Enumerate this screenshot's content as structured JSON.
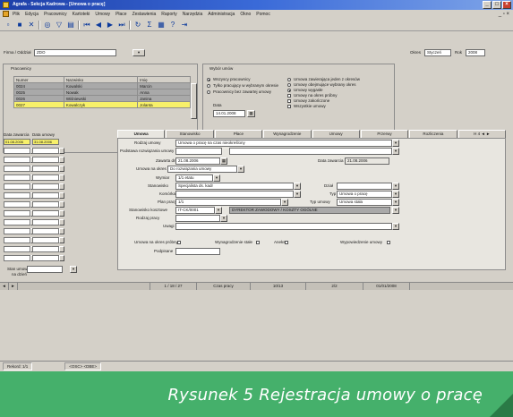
{
  "window": {
    "title": "Agrafa - Sekcja Kadrowa - [Umowa o pracę]"
  },
  "menu": [
    "Plik",
    "Edycja",
    "Pracownicy",
    "Kartoteki",
    "Umowy",
    "Płace",
    "Zestawienia",
    "Raporty",
    "Narzędzia",
    "Administracja",
    "Okno",
    "Pomoc"
  ],
  "toolbar": {
    "icons": [
      "new-icon",
      "save-icon",
      "delete-icon",
      "find-icon",
      "filter-icon",
      "print-icon",
      "first-icon",
      "prev-icon",
      "next-icon",
      "last-icon",
      "refresh-icon",
      "help-icon"
    ]
  },
  "header": {
    "firm_label": "Firma / Oddział",
    "firm_value": "ZDO",
    "year_label": "Rok",
    "year_value": "2008",
    "period_label": "Okres",
    "period_value": "Styczeń"
  },
  "employees": {
    "group_label": "Pracownicy",
    "columns": [
      "Numer",
      "Nazwisko",
      "Imię"
    ],
    "rows": [
      [
        "0024",
        "Kowalski",
        "Marcin"
      ],
      [
        "0025",
        "Nowak",
        "Anna"
      ],
      [
        "0026",
        "Wiśniewski",
        "Janina"
      ],
      [
        "0027",
        "Kowalczyk",
        "Jolanta"
      ]
    ],
    "selected_row": 3
  },
  "selection": {
    "group_label": "Wybór umów",
    "radios": [
      "Wszyscy pracownicy",
      "Tylko pracujący w wybranym okresie",
      "Pracownicy bez zawartej umowy"
    ],
    "date_label": "Data",
    "date_value": "14.01.2008",
    "checks": [
      "Umowa zawierająca jeden z okresów",
      "Umowy obejmujące wybrany okres",
      "Umowy wygasłe",
      "Umowy na okres próbny",
      "Umowy zakończone",
      "Wszystkie umowy"
    ]
  },
  "contracts": {
    "col_from": "Data zawarcia",
    "col_to": "Data umowy",
    "first_from": "01.08.2006",
    "first_to": "31.08.2006",
    "bottom_label": "Stan umowy",
    "bottom_label2": "na dzień"
  },
  "tabs": [
    "Umowa",
    "Stanowisko",
    "Płace",
    "Wynagrodzenie",
    "Umowy",
    "Przerwy",
    "Rozliczenia"
  ],
  "tab_nav": "H 4 ◄ ►",
  "form": {
    "type_label": "Rodzaj umowy",
    "type_value": "Umowa o pracę na czas nieokreślony",
    "reason_label": "Podstawa rozwiązania umowy",
    "date_from_label": "Zawarta dnia",
    "date_from_value": "21.08.2006",
    "date_to_label": "Umowa na okres",
    "date_to_value": "Do rozwiązania umowy",
    "date_sign_label": "Data zawarcia",
    "date_sign_value": "21.08.2006",
    "work_label": "Wymiar",
    "work_value": "1/1 etatu",
    "position_label": "Stanowisko",
    "position_value": "Specjalista ds. kadr",
    "division_label": "Dział",
    "plan_label": "Plan pracy",
    "plan_value": "1/1",
    "department_label": "Komórka",
    "kind_label": "Typ",
    "kind_value": "Umowa o pracę",
    "kind2_label": "Typ umowy",
    "kind2_value": "Umowa stała",
    "cost_label": "Stanowisko kosztowe",
    "cost_value": "IT-CK/0001",
    "cost_desc": "DYREKTOR ZAWODOWY / KOSZTY OGÓLNE",
    "other_label": "Rodzaj pracy",
    "notes_label": "Uwagi",
    "checks": [
      "Umowa na okres próbny",
      "Wynagrodzenie stałe",
      "Aneks",
      "Wypowiedzenie umowy"
    ],
    "sign_label": "Podpisane"
  },
  "summary": [
    "1 / 18 / 27",
    "Czas pracy",
    "10/13",
    "2/2",
    "01/01/2008"
  ],
  "status": {
    "record": "Rekord: 1/1",
    "mode": "<OSC> <DBE>"
  },
  "caption": "Rysunek 5 Rejestracja umowy o pracę"
}
